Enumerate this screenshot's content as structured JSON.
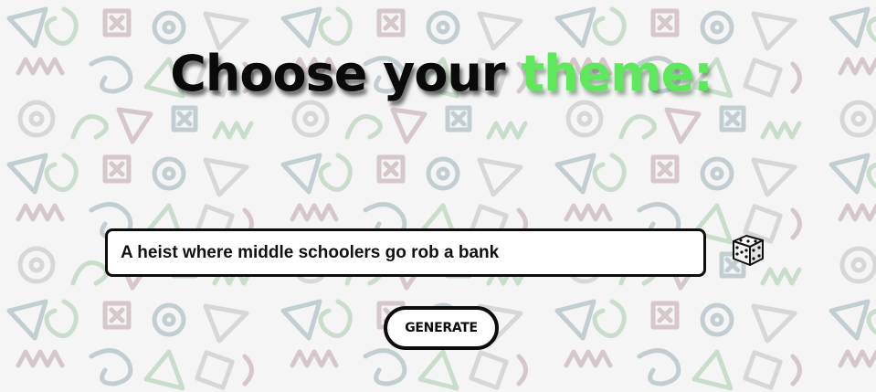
{
  "header": {
    "title_prefix": "Choose your",
    "title_accent": "theme:"
  },
  "form": {
    "theme_value": "A heist where middle schoolers go rob a bank",
    "generate_label": "GENERATE",
    "dice_icon": "dice-icon"
  },
  "colors": {
    "accent": "#5ee85c",
    "text": "#0a0a0a",
    "pattern": [
      "#8fa7b0",
      "#9fc4a3",
      "#b59a9f",
      "#b9b9b9"
    ]
  }
}
